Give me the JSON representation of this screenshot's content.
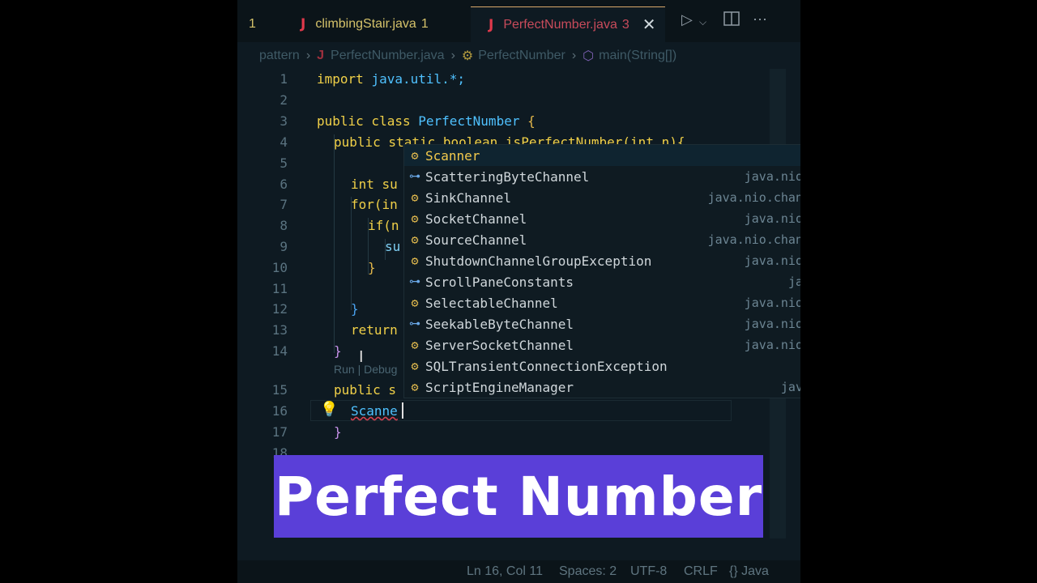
{
  "tabs": [
    {
      "label": "",
      "count": "1"
    },
    {
      "label": "climbingStair.java",
      "count": "1"
    },
    {
      "label": "PerfectNumber.java",
      "count": "3"
    }
  ],
  "tab_icon_letter": "J",
  "breadcrumb": [
    "pattern",
    "PerfectNumber.java",
    "PerfectNumber",
    "main(String[])"
  ],
  "line_numbers": [
    "1",
    "2",
    "3",
    "4",
    "5",
    "6",
    "7",
    "8",
    "9",
    "10",
    "11",
    "12",
    "13",
    "14",
    "15",
    "16",
    "17",
    "18"
  ],
  "code": {
    "l1": [
      "import",
      "java.util.*;"
    ],
    "l3": [
      "public class",
      "PerfectNumber",
      "{"
    ],
    "l4": [
      "public static boolean isPerfectNumber(int n){"
    ],
    "l6": [
      "int su"
    ],
    "l7": [
      "for(in"
    ],
    "l8": [
      "if(n"
    ],
    "l9": [
      "su"
    ],
    "l10": [
      "}"
    ],
    "l12": [
      "}"
    ],
    "l13": [
      "return"
    ],
    "l14": [
      "}"
    ],
    "l15": [
      "public s"
    ],
    "l16": [
      "Scanne"
    ],
    "l17": [
      "}"
    ]
  },
  "codelens": "Run | Debug",
  "suggestions": [
    {
      "name": "Scanner",
      "package": "",
      "kind": "class"
    },
    {
      "name": "ScatteringByteChannel",
      "package": "java.nio",
      "kind": "interface"
    },
    {
      "name": "SinkChannel",
      "package": "java.nio.chan",
      "kind": "class"
    },
    {
      "name": "SocketChannel",
      "package": "java.nio",
      "kind": "class"
    },
    {
      "name": "SourceChannel",
      "package": "java.nio.chan",
      "kind": "class"
    },
    {
      "name": "ShutdownChannelGroupException",
      "package": "java.nio",
      "kind": "class"
    },
    {
      "name": "ScrollPaneConstants",
      "package": "ja",
      "kind": "interface"
    },
    {
      "name": "SelectableChannel",
      "package": "java.nio",
      "kind": "class"
    },
    {
      "name": "SeekableByteChannel",
      "package": "java.nio",
      "kind": "interface"
    },
    {
      "name": "ServerSocketChannel",
      "package": "java.nio",
      "kind": "class"
    },
    {
      "name": "SQLTransientConnectionException",
      "package": "",
      "kind": "class"
    },
    {
      "name": "ScriptEngineManager",
      "package": "jav",
      "kind": "class"
    }
  ],
  "status": {
    "position": "Ln 16, Col 11",
    "spaces": "Spaces: 2",
    "encoding": "UTF-8",
    "eol": "CRLF",
    "language": "{} Java"
  },
  "overlay_title": "Perfect Number",
  "colors": {
    "overlay_bg": "#5a3fd8",
    "editor_bg": "#0e1a22",
    "keyword": "#f0d048",
    "accent_tab": "#c84b5b"
  }
}
